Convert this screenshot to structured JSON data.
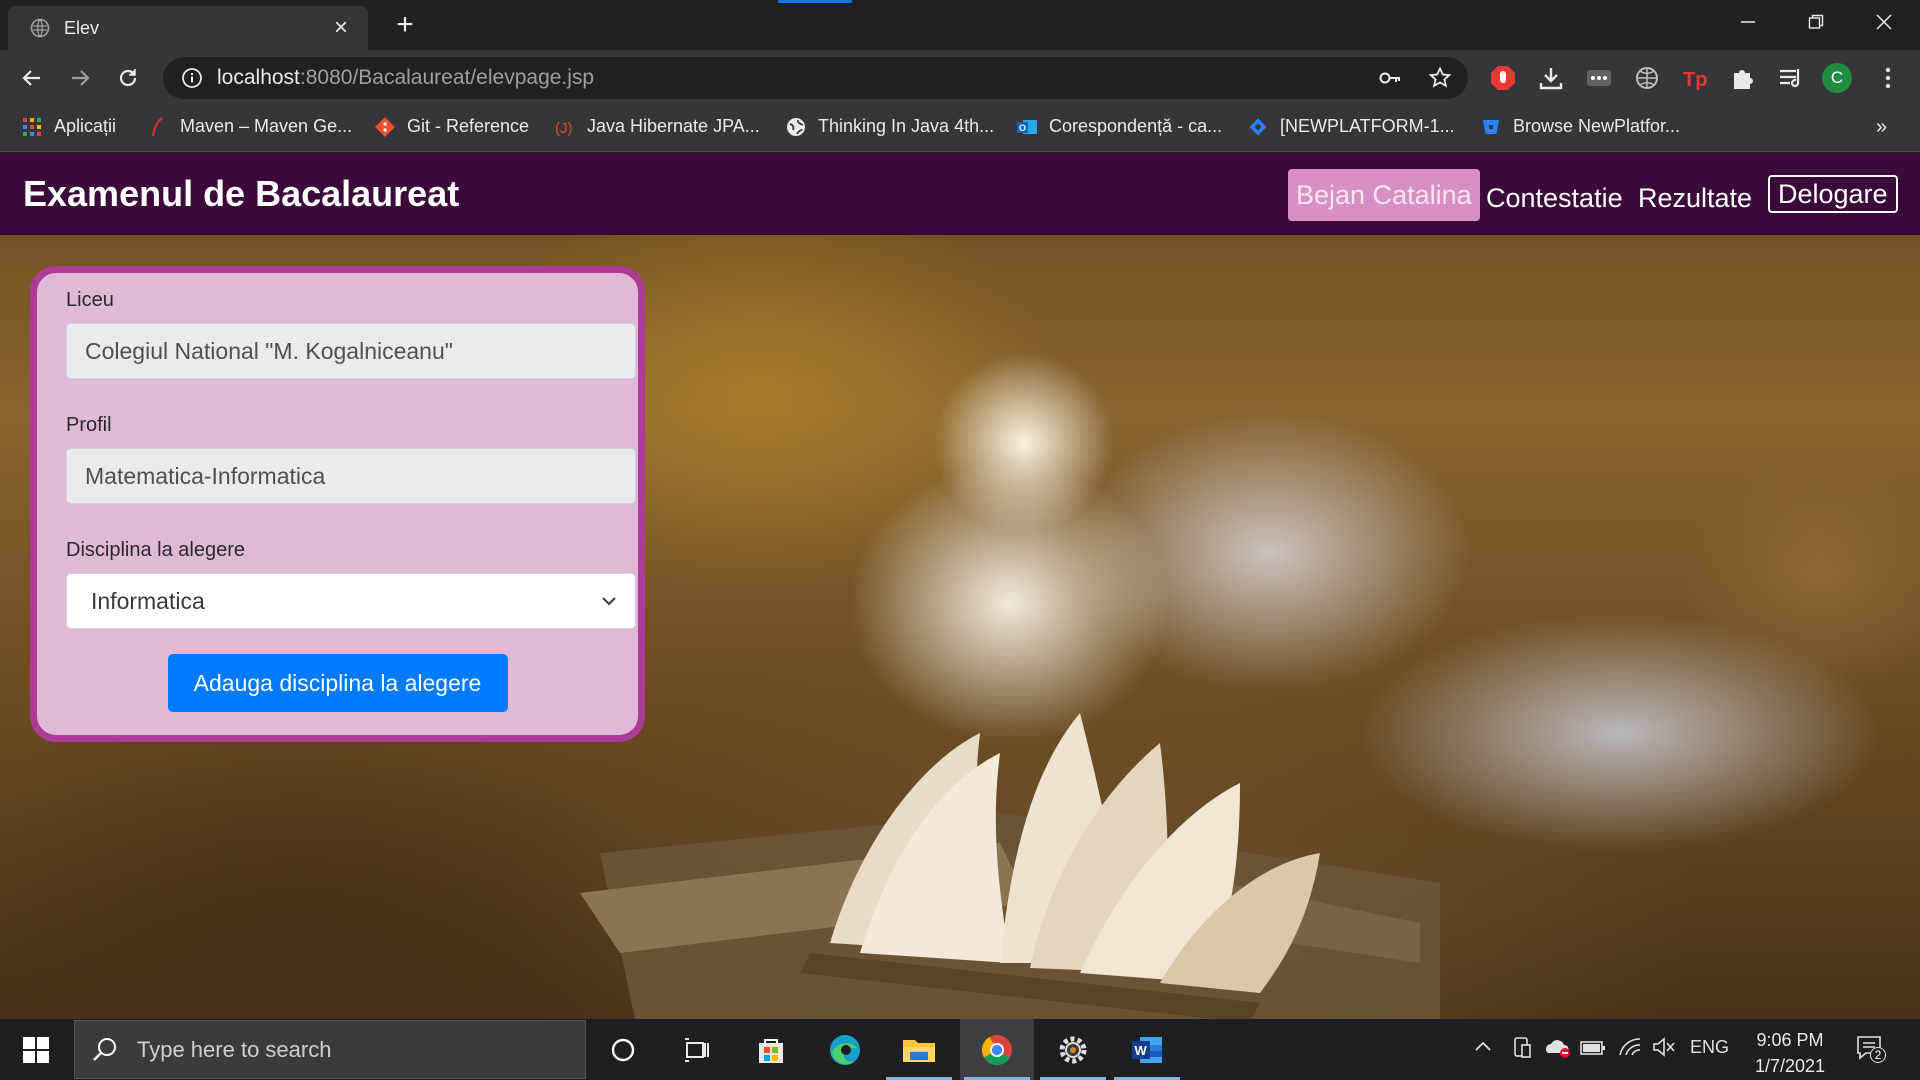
{
  "browser": {
    "tab_title": "Elev",
    "url_host": "localhost",
    "url_rest": ":8080/Bacalaureat/elevpage.jsp",
    "profile_initial": "C"
  },
  "bookmarks": [
    "Aplicații",
    "Maven – Maven Ge...",
    "Git - Reference",
    "Java Hibernate JPA...",
    "Thinking In Java 4th...",
    "Corespondență - ca...",
    "[NEWPLATFORM-1...",
    "Browse NewPlatfor..."
  ],
  "navbar": {
    "brand": "Examenul de Bacalaureat",
    "user": "Bejan Catalina",
    "link_contestatie": "Contestatie",
    "link_rezultate": "Rezultate",
    "link_delogare": "Delogare"
  },
  "form": {
    "liceu_label": "Liceu",
    "liceu_value": "Colegiul National \"M. Kogalniceanu\"",
    "profil_label": "Profil",
    "profil_value": "Matematica-Informatica",
    "disciplina_label": "Disciplina la alegere",
    "disciplina_value": "Informatica",
    "submit_label": "Adauga disciplina la alegere"
  },
  "taskbar": {
    "search_placeholder": "Type here to search",
    "language": "ENG",
    "time": "9:06 PM",
    "date": "1/7/2021",
    "notification_count": "2"
  },
  "colors": {
    "navbar_bg": "#3b0a3a",
    "card_bg": "#dfb9d6",
    "card_border": "#b03a97",
    "active_user_bg": "#d88fc4",
    "button_primary": "#007bff"
  }
}
